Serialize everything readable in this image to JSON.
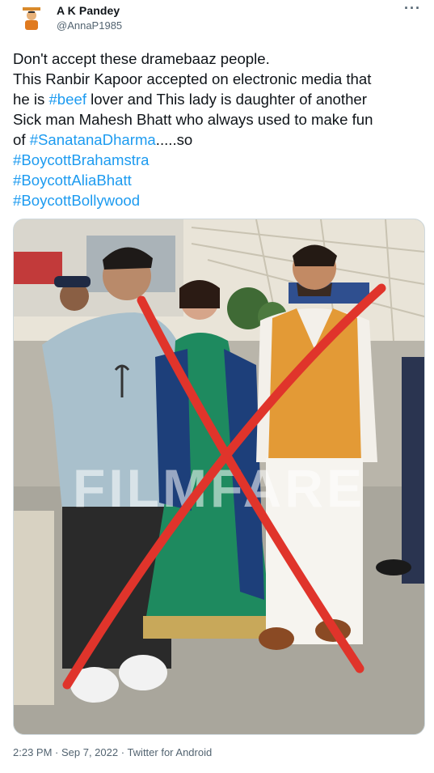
{
  "author": {
    "name": "A K Pandey",
    "handle": "@AnnaP1985",
    "avatar_icon": "saffron-figure-avatar-icon"
  },
  "more_icon": "more-options-icon",
  "tweet_lines": [
    [
      {
        "t": "Don't accept these dramebaaz people.",
        "link": false
      }
    ],
    [
      {
        "t": "This Ranbir Kapoor accepted on electronic media that",
        "link": false
      }
    ],
    [
      {
        "t": "he is ",
        "link": false
      },
      {
        "t": "#beef",
        "link": true
      },
      {
        "t": " lover and This lady is daughter of another",
        "link": false
      }
    ],
    [
      {
        "t": "Sick man Mahesh Bhatt who always used to make fun",
        "link": false
      }
    ],
    [
      {
        "t": "of ",
        "link": false
      },
      {
        "t": "#SanatanaDharma",
        "link": true
      },
      {
        "t": ".....so",
        "link": false
      }
    ],
    [
      {
        "t": "#BoycottBrahamstra",
        "link": true
      }
    ],
    [
      {
        "t": "#BoycottAliaBhatt",
        "link": true
      }
    ],
    [
      {
        "t": "#BoycottBollywood",
        "link": true
      }
    ]
  ],
  "media": {
    "watermark": "FILMFARE",
    "overlay_color": "#e0342b"
  },
  "meta": {
    "time": "2:23 PM",
    "sep": " · ",
    "date": "Sep 7, 2022",
    "source": "Twitter for Android"
  },
  "colors": {
    "link": "#1d9bf0",
    "secondary_text": "#536471"
  }
}
